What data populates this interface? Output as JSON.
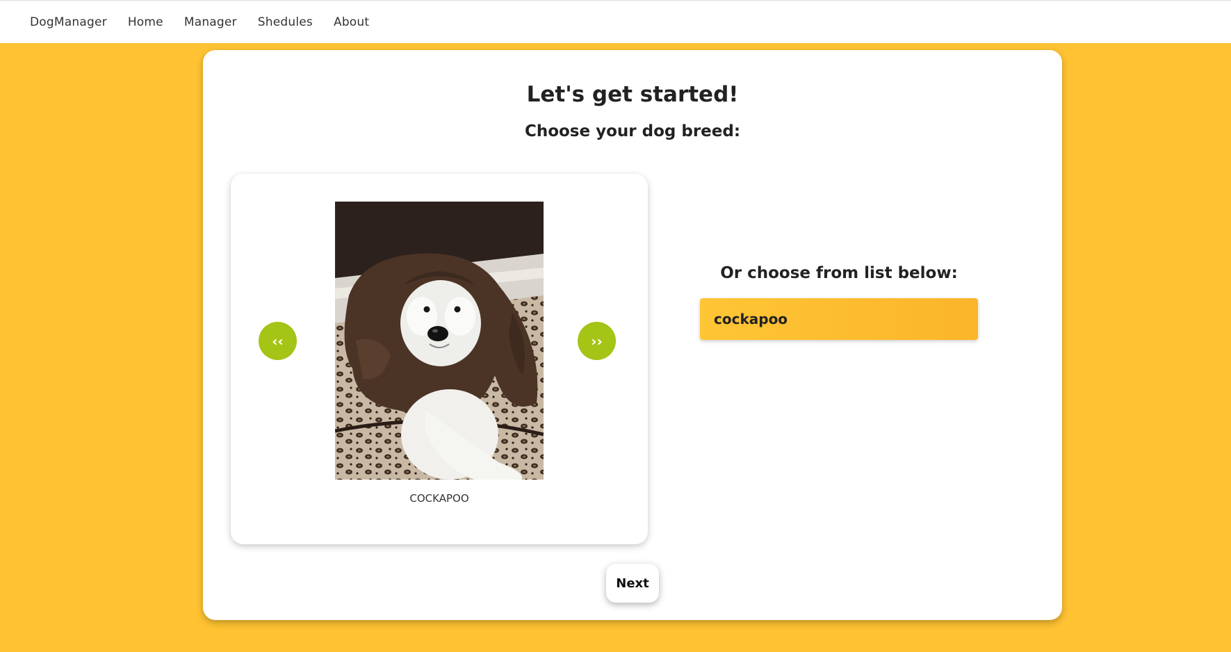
{
  "nav": {
    "brand": "DogManager",
    "items": [
      "Home",
      "Manager",
      "Shedules",
      "About"
    ]
  },
  "main": {
    "title": "Let's get started!",
    "subtitle": "Choose your dog breed:",
    "carousel": {
      "prev_label": "‹‹",
      "next_label": "››",
      "caption": "COCKAPOO",
      "image_alt": "cockapoo"
    },
    "list_label": "Or choose from list below:",
    "select": {
      "value": "cockapoo"
    },
    "next_button": "Next"
  },
  "colors": {
    "background": "#fec232",
    "accent_green": "#a4c416",
    "select_gradient_start": "#fec535",
    "select_gradient_end": "#fbb52a"
  }
}
